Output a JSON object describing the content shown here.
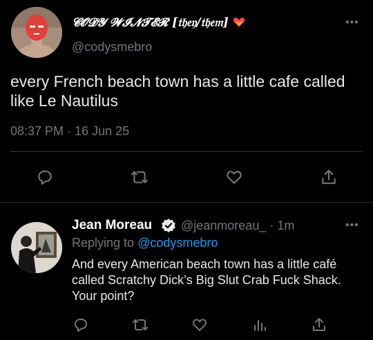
{
  "main_tweet": {
    "display_name": "𝓒𝓞𝓓𝓨 𝓦𝓘𝓝𝓣𝓔𝓡 [𝔱𝔥𝔢𝔶/𝔱𝔥𝔢𝔪]",
    "name_emoji_icon": "heart-on-fire-icon",
    "handle": "@codysmebro",
    "text": "every French beach town has a little cafe called like Le Nautilus",
    "time": "08:37 PM",
    "separator": "·",
    "date": "16 Jun 25",
    "actions": [
      "reply-icon",
      "retweet-icon",
      "like-icon",
      "share-icon"
    ]
  },
  "reply_tweet": {
    "display_name": "Jean Moreau",
    "verified_icon": "verified-badge-icon",
    "handle": "@jeanmoreau_",
    "separator": "·",
    "time": "1m",
    "replying_prefix": "Replying to",
    "replying_to": "@codysmebro",
    "text": "And every American beach town has a little café called Scratchy Dick’s Big Slut Crab Fuck Shack. Your point?",
    "actions": [
      "reply-icon",
      "retweet-icon",
      "like-icon",
      "analytics-icon",
      "share-icon"
    ]
  },
  "colors": {
    "background": "#000000",
    "text": "#e7e9ea",
    "muted": "#71767b",
    "link": "#1d9bf0",
    "divider": "#2f3336"
  }
}
